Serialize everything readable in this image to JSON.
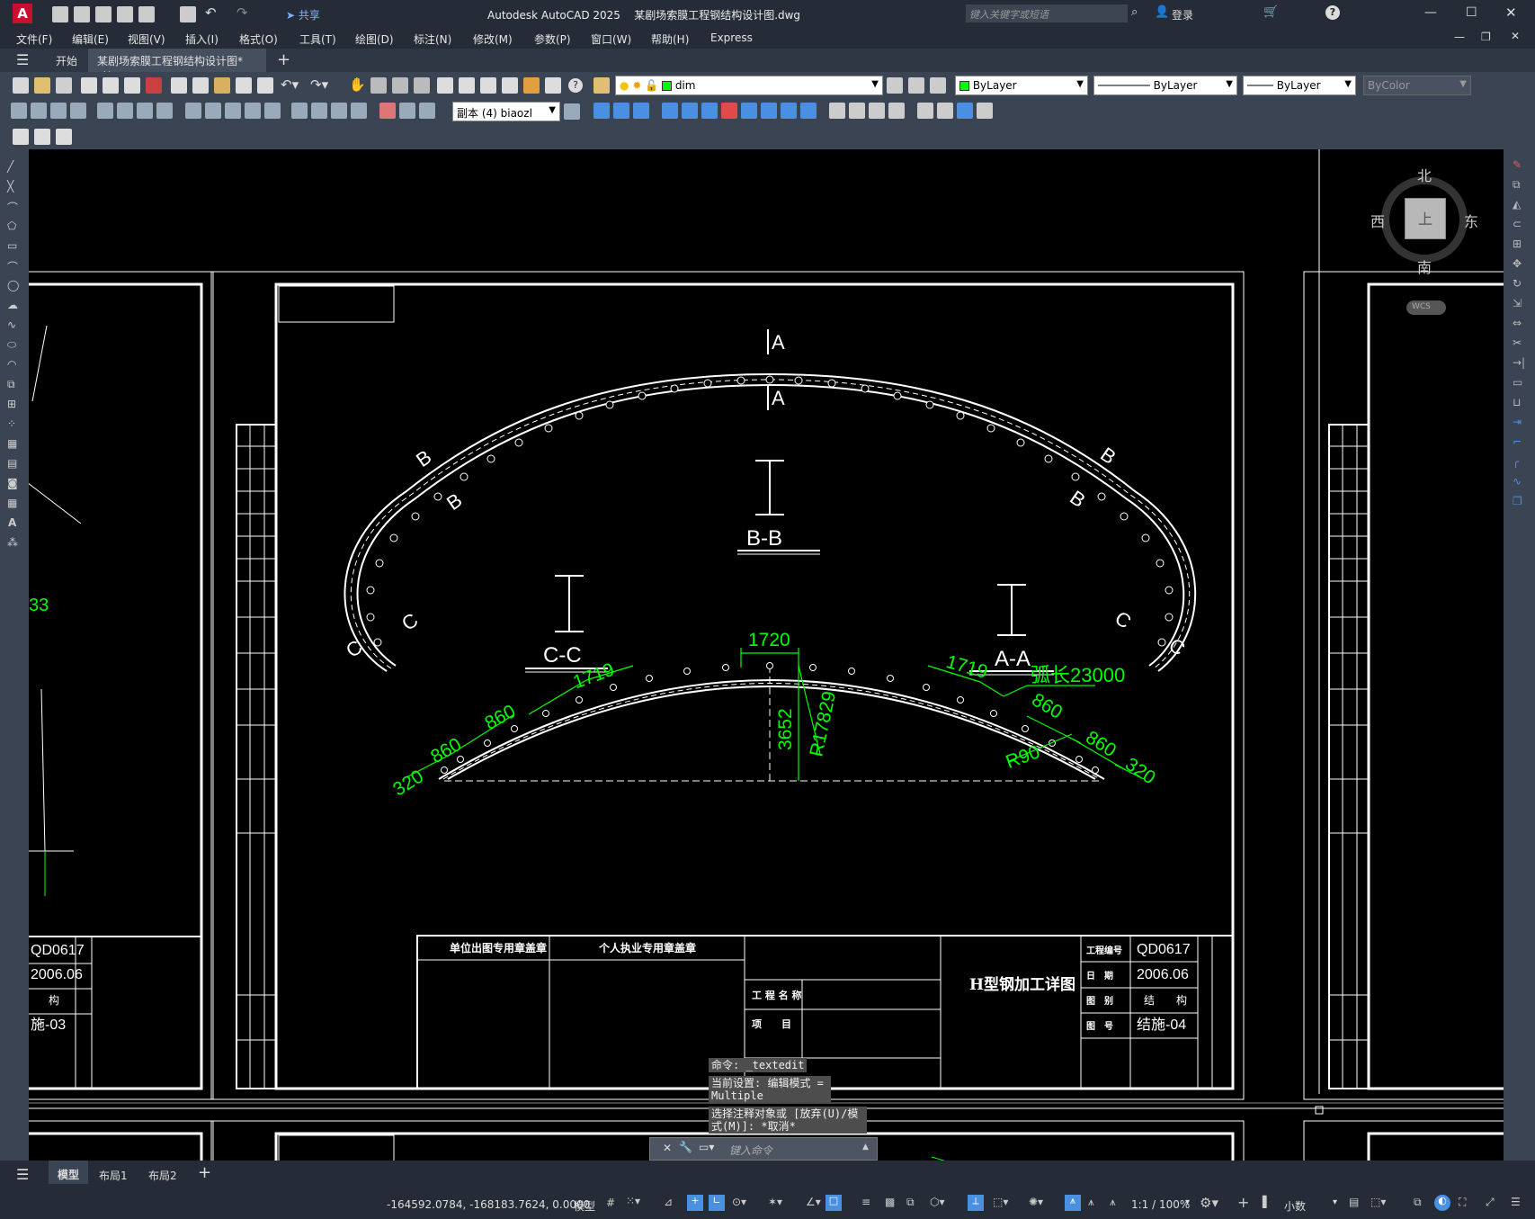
{
  "app": {
    "title": "Autodesk AutoCAD 2025",
    "filename": "某剧场索膜工程钢结构设计图.dwg"
  },
  "titlebar": {
    "share": "共享",
    "search_placeholder": "键入关键字或短语",
    "login": "登录"
  },
  "menu": [
    "文件(F)",
    "编辑(E)",
    "视图(V)",
    "插入(I)",
    "格式(O)",
    "工具(T)",
    "绘图(D)",
    "标注(N)",
    "修改(M)",
    "参数(P)",
    "窗口(W)",
    "帮助(H)",
    "Express"
  ],
  "tabs": {
    "start": "开始",
    "active": "某剧场索膜工程钢结构设计图*"
  },
  "toolbar": {
    "layer": "dim",
    "color": "ByLayer",
    "linetype": "ByLayer",
    "lineweight": "ByLayer",
    "plotstyle": "ByColor",
    "dimstyle": "副本 (4) biaozl"
  },
  "viewcube": {
    "north": "北",
    "south": "南",
    "east": "东",
    "west": "西",
    "face": "上",
    "wcs": "WCS"
  },
  "drawing": {
    "sections": {
      "aa": "A-A",
      "bb": "B-B",
      "cc": "C-C"
    },
    "cut_labels": {
      "a": "A",
      "b": "B",
      "c": "C"
    },
    "dims": {
      "d1720": "1720",
      "d1719": "1719",
      "d860": "860",
      "d320": "320",
      "d3652": "3652",
      "r17829": "R17829",
      "r90": "R90",
      "arc": "弧长23000"
    },
    "titleblock": {
      "stamp_unit": "单位出图专用章盖章",
      "stamp_personal": "个人执业专用章盖章",
      "project_name": "工 程 名 称",
      "item": "项　　目",
      "drawing_title": "H型钢加工详图",
      "proj_no_label": "工程编号",
      "proj_no": "QD0617",
      "date_label": "日　期",
      "date": "2006.06",
      "type_label": "图　别",
      "type": "结　　构",
      "num_label": "图　号",
      "num": "结施-04",
      "left_no": "QD0617",
      "left_date": "2006.06",
      "left_type": "构",
      "left_num": "施-03",
      "side_left_text": "33"
    }
  },
  "command": {
    "history": [
      "命令: _textedit",
      "当前设置: 编辑模式 = Multiple",
      "选择注释对象或 [放弃(U)/模式(M)]: *取消*"
    ],
    "placeholder": "键入命令"
  },
  "layouts": {
    "model": "模型",
    "layout1": "布局1",
    "layout2": "布局2"
  },
  "status": {
    "coords": "-164592.0784, -168183.7624, 0.0000",
    "model": "模型",
    "scale": "1:1 / 100%",
    "units": "小数"
  }
}
